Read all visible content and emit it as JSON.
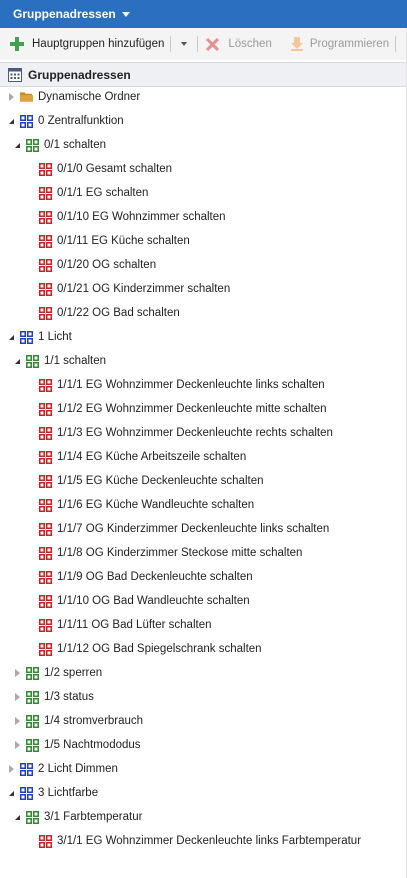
{
  "title": {
    "label": "Gruppenadressen"
  },
  "toolbar": {
    "add_label": "Hauptgruppen hinzufügen",
    "delete_label": "Löschen",
    "program_label": "Programmieren"
  },
  "panel": {
    "header": "Gruppenadressen"
  },
  "colors": {
    "main_group": "#1e3fd0",
    "middle_group": "#2e8b2e",
    "group_address": "#cc2222",
    "folder": "#e0a23a"
  },
  "tree": [
    {
      "label": "Dynamische Ordner",
      "level": 0,
      "kind": "folder",
      "state": "collapsed"
    },
    {
      "label": "0 Zentralfunktion",
      "level": 0,
      "kind": "main",
      "state": "expanded"
    },
    {
      "label": "0/1 schalten",
      "level": 1,
      "kind": "middle",
      "state": "expanded"
    },
    {
      "label": "0/1/0 Gesamt schalten",
      "level": 2,
      "kind": "address",
      "state": "none"
    },
    {
      "label": "0/1/1 EG schalten",
      "level": 2,
      "kind": "address",
      "state": "none"
    },
    {
      "label": "0/1/10 EG Wohnzimmer schalten",
      "level": 2,
      "kind": "address",
      "state": "none"
    },
    {
      "label": "0/1/11 EG Küche schalten",
      "level": 2,
      "kind": "address",
      "state": "none"
    },
    {
      "label": "0/1/20 OG schalten",
      "level": 2,
      "kind": "address",
      "state": "none"
    },
    {
      "label": "0/1/21 OG Kinderzimmer schalten",
      "level": 2,
      "kind": "address",
      "state": "none"
    },
    {
      "label": "0/1/22 OG Bad schalten",
      "level": 2,
      "kind": "address",
      "state": "none"
    },
    {
      "label": "1 Licht",
      "level": 0,
      "kind": "main",
      "state": "expanded"
    },
    {
      "label": "1/1 schalten",
      "level": 1,
      "kind": "middle",
      "state": "expanded"
    },
    {
      "label": "1/1/1 EG Wohnzimmer Deckenleuchte links schalten",
      "level": 2,
      "kind": "address",
      "state": "none"
    },
    {
      "label": "1/1/2 EG Wohnzimmer Deckenleuchte mitte schalten",
      "level": 2,
      "kind": "address",
      "state": "none"
    },
    {
      "label": "1/1/3 EG Wohnzimmer Deckenleuchte rechts schalten",
      "level": 2,
      "kind": "address",
      "state": "none"
    },
    {
      "label": "1/1/4 EG Küche Arbeitszeile schalten",
      "level": 2,
      "kind": "address",
      "state": "none"
    },
    {
      "label": "1/1/5 EG Küche Deckenleuchte schalten",
      "level": 2,
      "kind": "address",
      "state": "none"
    },
    {
      "label": "1/1/6 EG Küche Wandleuchte schalten",
      "level": 2,
      "kind": "address",
      "state": "none"
    },
    {
      "label": "1/1/7 OG Kinderzimmer Deckenleuchte links schalten",
      "level": 2,
      "kind": "address",
      "state": "none"
    },
    {
      "label": "1/1/8 OG Kinderzimmer Steckose mitte schalten",
      "level": 2,
      "kind": "address",
      "state": "none"
    },
    {
      "label": "1/1/9 OG Bad Deckenleuchte schalten",
      "level": 2,
      "kind": "address",
      "state": "none"
    },
    {
      "label": "1/1/10 OG Bad Wandleuchte schalten",
      "level": 2,
      "kind": "address",
      "state": "none"
    },
    {
      "label": "1/1/11 OG Bad Lüfter schalten",
      "level": 2,
      "kind": "address",
      "state": "none"
    },
    {
      "label": "1/1/12 OG Bad Spiegelschrank schalten",
      "level": 2,
      "kind": "address",
      "state": "none"
    },
    {
      "label": "1/2 sperren",
      "level": 1,
      "kind": "middle",
      "state": "collapsed"
    },
    {
      "label": "1/3 status",
      "level": 1,
      "kind": "middle",
      "state": "collapsed"
    },
    {
      "label": "1/4 stromverbrauch",
      "level": 1,
      "kind": "middle",
      "state": "collapsed"
    },
    {
      "label": "1/5 Nachtmododus",
      "level": 1,
      "kind": "middle",
      "state": "collapsed"
    },
    {
      "label": "2 Licht Dimmen",
      "level": 0,
      "kind": "main",
      "state": "collapsed"
    },
    {
      "label": "3 Lichtfarbe",
      "level": 0,
      "kind": "main",
      "state": "expanded"
    },
    {
      "label": "3/1 Farbtemperatur",
      "level": 1,
      "kind": "middle",
      "state": "expanded"
    },
    {
      "label": "3/1/1 EG Wohnzimmer Deckenleuchte links Farbtemperatur",
      "level": 2,
      "kind": "address",
      "state": "none"
    }
  ]
}
